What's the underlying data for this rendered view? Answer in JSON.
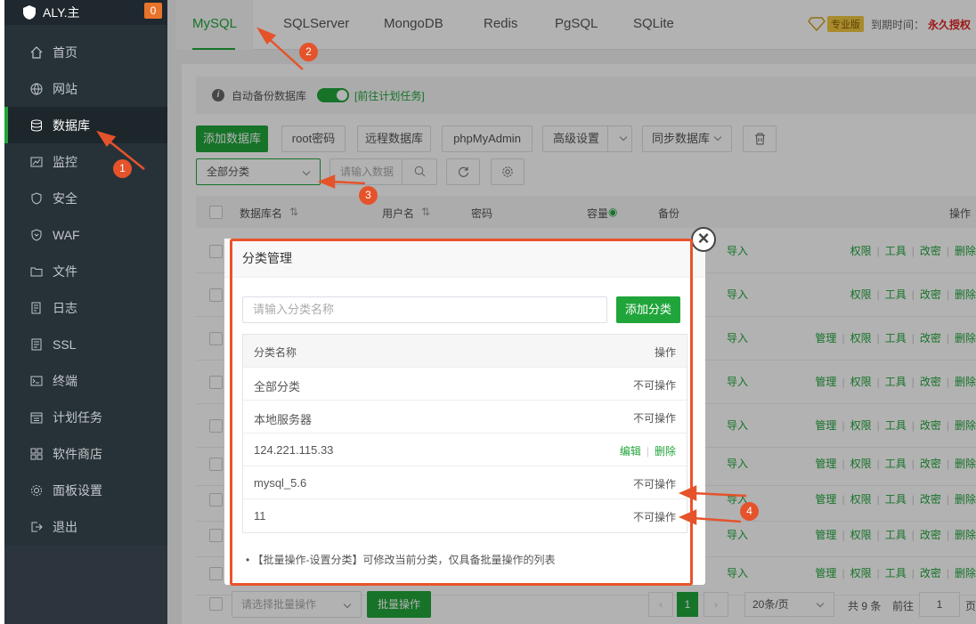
{
  "sidebar": {
    "brand": "ALY.主",
    "badge": "0",
    "items": [
      {
        "label": "首页",
        "icon": "home-icon",
        "active": false
      },
      {
        "label": "网站",
        "icon": "globe-icon",
        "active": false
      },
      {
        "label": "数据库",
        "icon": "database-icon",
        "active": true
      },
      {
        "label": "监控",
        "icon": "chart-icon",
        "active": false
      },
      {
        "label": "安全",
        "icon": "shield-icon",
        "active": false
      },
      {
        "label": "WAF",
        "icon": "waf-shield-icon",
        "active": false
      },
      {
        "label": "文件",
        "icon": "folder-icon",
        "active": false
      },
      {
        "label": "日志",
        "icon": "log-icon",
        "active": false
      },
      {
        "label": "SSL",
        "icon": "ssl-icon",
        "active": false
      },
      {
        "label": "终端",
        "icon": "terminal-icon",
        "active": false
      },
      {
        "label": "计划任务",
        "icon": "calendar-icon",
        "active": false
      },
      {
        "label": "软件商店",
        "icon": "grid-icon",
        "active": false
      },
      {
        "label": "面板设置",
        "icon": "gear-icon",
        "active": false
      },
      {
        "label": "退出",
        "icon": "logout-icon",
        "active": false
      }
    ]
  },
  "tabs": [
    {
      "label": "MySQL",
      "active": true
    },
    {
      "label": "SQLServer"
    },
    {
      "label": "MongoDB"
    },
    {
      "label": "Redis"
    },
    {
      "label": "PgSQL"
    },
    {
      "label": "SQLite"
    }
  ],
  "pro": {
    "badge": "专业版",
    "expire_label": "到期时间：",
    "expire_value": "永久授权"
  },
  "autobackup": {
    "label": "自动备份数据库",
    "link": "[前往计划任务]"
  },
  "toolbar": {
    "add": "添加数据库",
    "root": "root密码",
    "remote": "远程数据库",
    "pma": "phpMyAdmin",
    "advanced": "高级设置",
    "sync": "同步数据库",
    "category": "全部分类",
    "search_placeholder": "请输入数据"
  },
  "table": {
    "headers": [
      "数据库名",
      "用户名",
      "密码",
      "容量",
      "备份",
      "操作"
    ],
    "backup_link": "导入",
    "actions": [
      "管理",
      "权限",
      "工具",
      "改密",
      "删除"
    ]
  },
  "footer": {
    "batch_placeholder": "请选择批量操作",
    "batch_button": "批量操作",
    "page": "1",
    "per_page": "20条/页",
    "total": "共 9 条",
    "goto_label": "前往",
    "goto_value": "1",
    "page_suffix": "页"
  },
  "dialog": {
    "title": "分类管理",
    "input_placeholder": "请输入分类名称",
    "add_button": "添加分类",
    "col_name": "分类名称",
    "col_action": "操作",
    "rows": [
      {
        "name": "全部分类",
        "action": "不可操作"
      },
      {
        "name": "本地服务器",
        "action": "不可操作"
      },
      {
        "name": "124.221.115.33",
        "edit": "编辑",
        "delete": "删除"
      },
      {
        "name": "mysql_5.6",
        "action": "不可操作"
      },
      {
        "name": "11",
        "action": "不可操作"
      }
    ],
    "note": "【批量操作-设置分类】可修改当前分类，仅具备批量操作的列表"
  },
  "annotations": [
    "1",
    "2",
    "3",
    "4"
  ]
}
